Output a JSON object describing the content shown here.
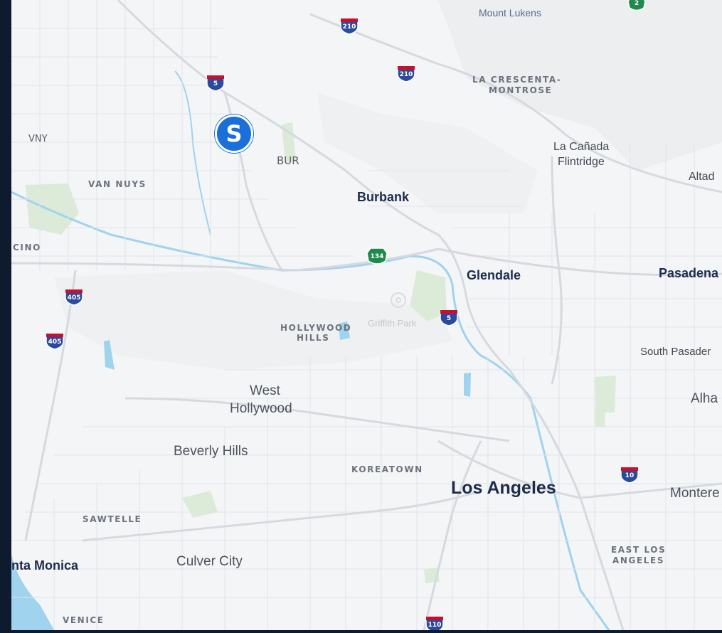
{
  "map": {
    "marker": {
      "letter": "S",
      "icon": "pin-marker-icon",
      "color": "#1a6fd8"
    },
    "labels": {
      "mount_lukens": "Mount Lukens",
      "la_crescenta": "LA CRESCENTA-",
      "montrose": "MONTROSE",
      "vny": "VNY",
      "bur": "BUR",
      "van_nuys": "VAN NUYS",
      "la_canada_1": "La Cañada",
      "la_canada_2": "Flintridge",
      "altadena": "Altad",
      "burbank": "Burbank",
      "encino": "CINO",
      "glendale": "Glendale",
      "pasadena": "Pasadena",
      "hollywood_hills_1": "HOLLYWOOD",
      "hollywood_hills_2": "HILLS",
      "griffith_park": "Griffith Park",
      "south_pasadena": "South Pasader",
      "west_hollywood_1": "West",
      "west_hollywood_2": "Hollywood",
      "alhambra": "Alha",
      "beverly_hills": "Beverly Hills",
      "koreatown": "KOREATOWN",
      "los_angeles": "Los Angeles",
      "monterey": "Montere",
      "sawtelle": "SAWTELLE",
      "east_la_1": "EAST LOS",
      "east_la_2": "ANGELES",
      "santa_monica": "nta Monica",
      "culver_city": "Culver City",
      "venice": "VENICE"
    },
    "shields": {
      "i210_a": "210",
      "i210_b": "210",
      "i5_a": "5",
      "i5_b": "5",
      "ca134": "134",
      "i405_a": "405",
      "i405_b": "405",
      "i10": "10",
      "i110": "110",
      "ca2": "2"
    },
    "colors": {
      "land": "#f4f5f7",
      "water": "#9fd3ee",
      "park": "#dcebd8",
      "road": "#d9dce3",
      "interstate": "#2b4a9c"
    }
  }
}
